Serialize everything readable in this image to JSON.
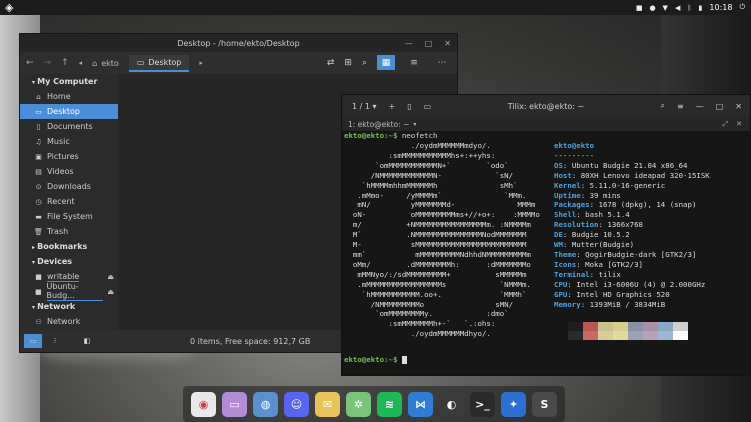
{
  "topbar": {
    "menu_icon": "budgie-menu-icon",
    "clock": "10:18",
    "tray_icons": [
      "square-icon",
      "notification-icon",
      "wifi-icon",
      "volume-icon",
      "bluetooth-icon",
      "battery-icon"
    ]
  },
  "file_manager": {
    "title": "Desktop - /home/ekto/Desktop",
    "path": [
      {
        "label": "ekto"
      },
      {
        "label": "Desktop"
      }
    ],
    "sidebar": {
      "my_computer": "My Computer",
      "places": [
        {
          "label": "Home",
          "icon": "home-icon"
        },
        {
          "label": "Desktop",
          "icon": "desktop-icon"
        },
        {
          "label": "Documents",
          "icon": "document-icon"
        },
        {
          "label": "Music",
          "icon": "music-icon"
        },
        {
          "label": "Pictures",
          "icon": "pictures-icon"
        },
        {
          "label": "Videos",
          "icon": "videos-icon"
        },
        {
          "label": "Downloads",
          "icon": "downloads-icon"
        },
        {
          "label": "Recent",
          "icon": "recent-icon"
        },
        {
          "label": "File System",
          "icon": "filesystem-icon"
        },
        {
          "label": "Trash",
          "icon": "trash-icon"
        }
      ],
      "bookmarks": "Bookmarks",
      "devices_header": "Devices",
      "devices": [
        {
          "label": "writable"
        },
        {
          "label": "Ubuntu-Budg..."
        }
      ],
      "network_header": "Network",
      "network_item": "Network"
    },
    "status": "0 items, Free space: 912,7 GB"
  },
  "terminal": {
    "tab_count": "1 / 1",
    "title": "Tilix: ekto@ekto: ~",
    "subtitle": "1: ekto@ekto: ~",
    "prompt": "ekto@ekto:~$",
    "command": "neofetch",
    "ascii": [
      "               ./oydmMMMMMMmdyo/.",
      "          :smMMMMMMMMMMMhs+:++yhs:",
      "       `omMMMMMMMMMMMN+`        `odo`",
      "      /NMMMMMMMMMMMMN-            `sN/",
      "    `hMMMMmhhmMMMMMMh              sMh`",
      "   .mMmo-     /yMMMMm`              `MMm.",
      "   mN/         yMMMMMMMd-              MMMm",
      "  oN-          oMMMMMMMMMms+//+o+:    :MMMMo",
      "  m/          +NMMMMMMMMMMMMMMMMm. :NMMMMm",
      "  M`          .NMMMMMMMMMMMMMMMNodMMMMMMM",
      "  M-           sMMMMMMMMMMMMMMMMMMMMMMMMM",
      "  mm`           mMMMMMMMMMNdhhdNMMMMMMMMMm",
      "  oMm/        .dMMMMMMMMh:      :dMMMMMMMo",
      "   mMMNyo/:/sdMMMMMMMMM+          sMMMMMm",
      "   .mMMMMMMMMMMMMMMMMMs            `NMMMm.",
      "    `hMMMMMMMMMMM.oo+.             `MMMh`",
      "      /NMMMMMMMMMo                sMN/",
      "       `omMMMMMMMMy.            :dmo`",
      "          :smMMMMMMMh+-`   `.:ohs:",
      "               ./oydmMMMMMMdhyo/."
    ],
    "info_header": "ekto@ekto",
    "info_sep": "---------",
    "info": [
      {
        "key": "OS",
        "value": "Ubuntu Budgie 21.04 x86_64"
      },
      {
        "key": "Host",
        "value": "80XH Lenovo ideapad 320-15ISK"
      },
      {
        "key": "Kernel",
        "value": "5.11.0-16-generic"
      },
      {
        "key": "Uptime",
        "value": "39 mins"
      },
      {
        "key": "Packages",
        "value": "1678 (dpkg), 14 (snap)"
      },
      {
        "key": "Shell",
        "value": "bash 5.1.4"
      },
      {
        "key": "Resolution",
        "value": "1366x768"
      },
      {
        "key": "DE",
        "value": "Budgie 10.5.2"
      },
      {
        "key": "WM",
        "value": "Mutter(Budgie)"
      },
      {
        "key": "Theme",
        "value": "QogirBudgie-dark [GTK2/3]"
      },
      {
        "key": "Icons",
        "value": "Moka [GTK2/3]"
      },
      {
        "key": "Terminal",
        "value": "tilix"
      },
      {
        "key": "CPU",
        "value": "Intel i3-6006U (4) @ 2.000GHz"
      },
      {
        "key": "GPU",
        "value": "Intel HD Graphics 520"
      },
      {
        "key": "Memory",
        "value": "1393MiB / 3834MiB"
      }
    ],
    "palette": [
      "#1e1e1e",
      "#b8574f",
      "#c9c28a",
      "#d8cf8f",
      "#8891a6",
      "#a88fa6",
      "#88a8c8",
      "#cfcfcf",
      "#2b2b2b",
      "#c76a60",
      "#d6ce94",
      "#e2da9c",
      "#98a2b8",
      "#b9a1b8",
      "#9ab8d6",
      "#ffffff"
    ]
  },
  "dock": [
    {
      "name": "chrome-icon",
      "color": "#e8e8e8",
      "glyph": "◉"
    },
    {
      "name": "files-icon",
      "color": "#b48bd6",
      "glyph": "▭"
    },
    {
      "name": "browser-icon",
      "color": "#5a8fd0",
      "glyph": "◍"
    },
    {
      "name": "discord-icon",
      "color": "#5865f2",
      "glyph": "☺"
    },
    {
      "name": "mail-icon",
      "color": "#e8c25a",
      "glyph": "✉"
    },
    {
      "name": "settings-icon",
      "color": "#7ac47a",
      "glyph": "✲"
    },
    {
      "name": "spotify-icon",
      "color": "#1db954",
      "glyph": "≋"
    },
    {
      "name": "vscode-icon",
      "color": "#2c7ed6",
      "glyph": "⋈"
    },
    {
      "name": "github-icon",
      "color": "#3a3a3a",
      "glyph": "◐"
    },
    {
      "name": "terminal-icon",
      "color": "#2a2a2a",
      "glyph": ">_"
    },
    {
      "name": "app-icon",
      "color": "#2b6fd0",
      "glyph": "✦"
    },
    {
      "name": "sublime-icon",
      "color": "#4a4a4a",
      "glyph": "S"
    }
  ]
}
